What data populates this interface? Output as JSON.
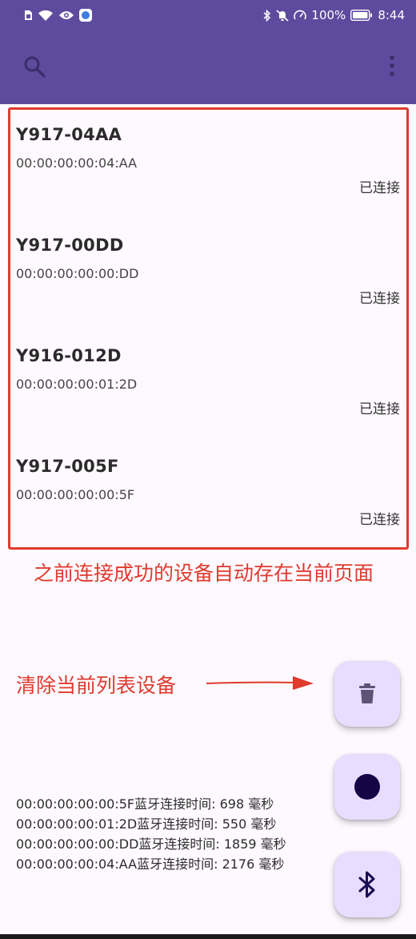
{
  "status_bar": {
    "battery": "100%",
    "time": "8:44",
    "icons": [
      "sim-icon",
      "wifi-icon",
      "eye-icon",
      "app-icon",
      "bluetooth-icon",
      "mute-icon",
      "speed-icon",
      "battery-icon"
    ]
  },
  "app_bar": {
    "color": "#5e4b9e",
    "icons": [
      "search-icon",
      "more-vert-icon"
    ]
  },
  "devices": [
    {
      "name": "Y917-04AA",
      "mac": "00:00:00:00:04:AA",
      "status": "已连接"
    },
    {
      "name": "Y917-00DD",
      "mac": "00:00:00:00:00:DD",
      "status": "已连接"
    },
    {
      "name": "Y916-012D",
      "mac": "00:00:00:00:01:2D",
      "status": "已连接"
    },
    {
      "name": "Y917-005F",
      "mac": "00:00:00:00:00:5F",
      "status": "已连接"
    }
  ],
  "annotations": {
    "saved_devices": "之前连接成功的设备自动存在当前页面",
    "clear_list": "清除当前列表设备",
    "color": "#e03a2e"
  },
  "log_lines": [
    "00:00:00:00:00:5F蓝牙连接时间: 698 毫秒",
    "00:00:00:00:01:2D蓝牙连接时间: 550 毫秒",
    "00:00:00:00:00:DD蓝牙连接时间: 1859 毫秒",
    "00:00:00:00:04:AA蓝牙连接时间: 2176 毫秒"
  ],
  "fabs": [
    {
      "icon": "trash-icon"
    },
    {
      "icon": "record-icon"
    },
    {
      "icon": "bluetooth-icon"
    }
  ]
}
